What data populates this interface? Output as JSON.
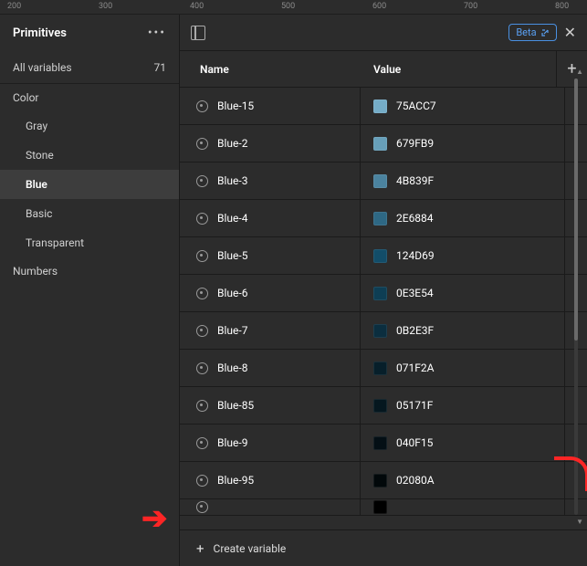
{
  "ruler": [
    "200",
    "300",
    "400",
    "500",
    "600",
    "700",
    "800"
  ],
  "sidebar": {
    "title": "Primitives",
    "all_label": "All variables",
    "all_count": "71",
    "sections": [
      {
        "label": "Color",
        "items": [
          "Gray",
          "Stone",
          "Blue",
          "Basic",
          "Transparent"
        ],
        "selected": "Blue"
      },
      {
        "label": "Numbers",
        "items": []
      }
    ]
  },
  "header": {
    "beta": "Beta"
  },
  "table": {
    "col_name": "Name",
    "col_value": "Value",
    "rows": [
      {
        "name": "Blue-15",
        "hex": "75ACC7"
      },
      {
        "name": "Blue-2",
        "hex": "679FB9"
      },
      {
        "name": "Blue-3",
        "hex": "4B839F"
      },
      {
        "name": "Blue-4",
        "hex": "2E6884"
      },
      {
        "name": "Blue-5",
        "hex": "124D69"
      },
      {
        "name": "Blue-6",
        "hex": "0E3E54"
      },
      {
        "name": "Blue-7",
        "hex": "0B2E3F"
      },
      {
        "name": "Blue-8",
        "hex": "071F2A"
      },
      {
        "name": "Blue-85",
        "hex": "05171F"
      },
      {
        "name": "Blue-9",
        "hex": "040F15"
      },
      {
        "name": "Blue-95",
        "hex": "02080A"
      }
    ]
  },
  "footer": {
    "create": "Create variable"
  }
}
